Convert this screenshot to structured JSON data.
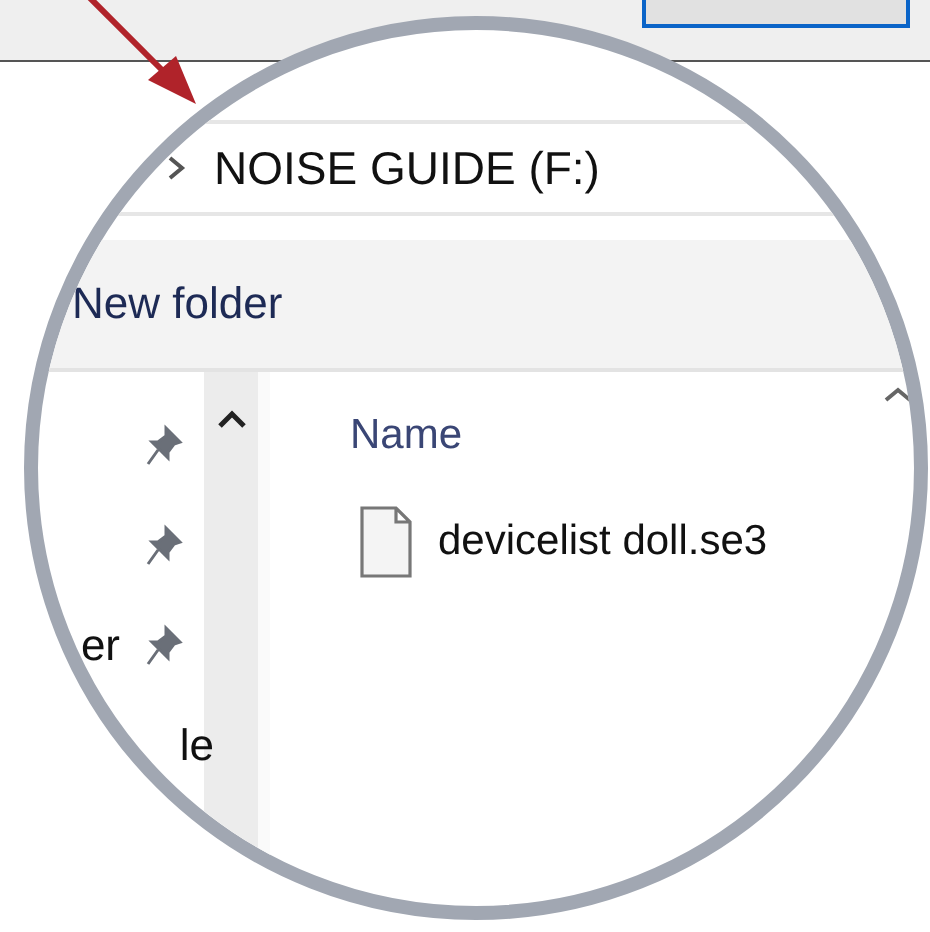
{
  "address_bar": {
    "path": "NOISE GUIDE (F:)"
  },
  "toolbar": {
    "new_folder": "New folder"
  },
  "navigation": [
    {
      "pinned": true
    },
    {
      "pinned": true
    },
    {
      "label": "er",
      "pinned": true
    },
    {
      "label": "le",
      "pinned": false
    }
  ],
  "file_list": {
    "column": "Name",
    "files": [
      {
        "name": "devicelist doll.se3"
      }
    ]
  }
}
